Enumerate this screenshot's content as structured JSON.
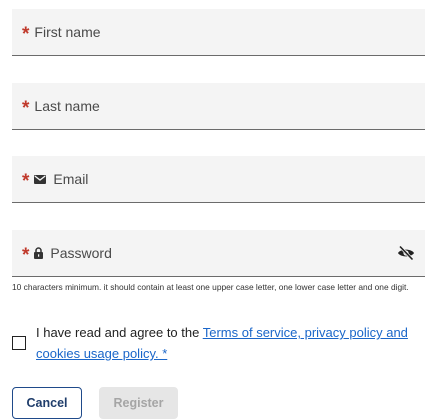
{
  "form": {
    "first_name": {
      "required_mark": "*",
      "label": "First name"
    },
    "last_name": {
      "required_mark": "*",
      "label": "Last name"
    },
    "email": {
      "required_mark": "*",
      "label": "Email",
      "icon": "envelope-icon"
    },
    "password": {
      "required_mark": "*",
      "label": "Password",
      "icon": "lock-icon",
      "toggle_icon": "eye-off-icon"
    },
    "password_hint": "10 characters minimum. it should contain at least one upper case letter, one lower case letter and one digit.",
    "agreement": {
      "text": "I have read and agree to the ",
      "link_text": "Terms of service, privacy policy and cookies usage policy. *",
      "checked": false
    },
    "buttons": {
      "cancel": "Cancel",
      "register": "Register"
    }
  },
  "colors": {
    "required": "#c0392b",
    "link": "#1a66c9",
    "field_bg": "#f4f4f4",
    "cancel_border": "#1f4a8a",
    "disabled_bg": "#e6e6e6",
    "disabled_text": "#a5a5a5"
  }
}
